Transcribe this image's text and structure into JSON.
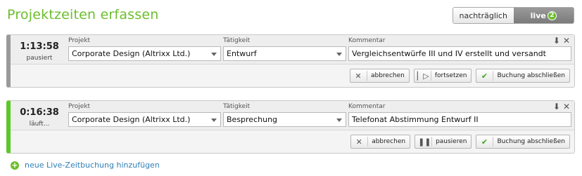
{
  "page": {
    "title": "Projektzeiten erfassen"
  },
  "mode": {
    "retro_label": "nachträglich",
    "live_label": "live",
    "live_count": "2",
    "active": "live"
  },
  "labels": {
    "project": "Projekt",
    "activity": "Tätigkeit",
    "comment": "Kommentar"
  },
  "icons": {
    "collapse": "chevron-double-down-icon",
    "close": "close-icon"
  },
  "entries": [
    {
      "time": "1:13:58",
      "state": "pausiert",
      "project": "Corporate Design (Altrixx Ltd.)",
      "activity": "Entwurf",
      "comment": "Vergleichsentwürfe III und IV erstellt und versandt",
      "buttons": {
        "cancel": "abbrechen",
        "toggle": "fortsetzen",
        "finish": "Buchung abschließen"
      }
    },
    {
      "time": "0:16:38",
      "state": "läuft...",
      "project": "Corporate Design (Altrixx Ltd.)",
      "activity": "Besprechung",
      "comment": "Telefonat Abstimmung Entwurf II",
      "buttons": {
        "cancel": "abbrechen",
        "toggle": "pausieren",
        "finish": "Buchung abschließen"
      }
    }
  ],
  "add_link": "neue Live-Zeitbuchung hinzufügen",
  "colors": {
    "accent": "#6cbe2c",
    "running": "#5cc827",
    "paused": "#9a9a9a",
    "link": "#2f7fb5"
  }
}
